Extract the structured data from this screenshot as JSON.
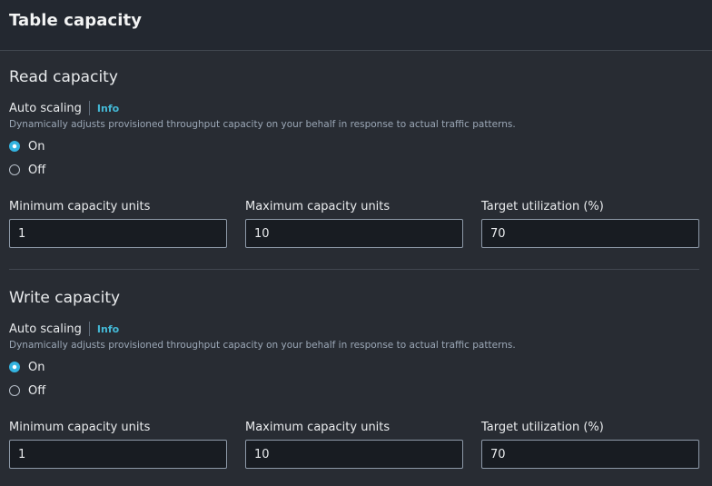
{
  "panel": {
    "title": "Table capacity"
  },
  "read_capacity": {
    "title": "Read capacity",
    "auto_scaling_label": "Auto scaling",
    "info_label": "Info",
    "description": "Dynamically adjusts provisioned throughput capacity on your behalf in response to actual traffic patterns.",
    "options": [
      {
        "label": "On",
        "selected": true
      },
      {
        "label": "Off",
        "selected": false
      }
    ],
    "min_label": "Minimum capacity units",
    "min_value": "1",
    "max_label": "Maximum capacity units",
    "max_value": "10",
    "target_label": "Target utilization (%)",
    "target_value": "70"
  },
  "write_capacity": {
    "title": "Write capacity",
    "auto_scaling_label": "Auto scaling",
    "info_label": "Info",
    "description": "Dynamically adjusts provisioned throughput capacity on your behalf in response to actual traffic patterns.",
    "options": [
      {
        "label": "On",
        "selected": true
      },
      {
        "label": "Off",
        "selected": false
      }
    ],
    "min_label": "Minimum capacity units",
    "min_value": "1",
    "max_label": "Maximum capacity units",
    "max_value": "10",
    "target_label": "Target utilization (%)",
    "target_value": "70"
  },
  "colors": {
    "background": "#282c33",
    "header_background": "#232830",
    "accent_link": "#44b9d6",
    "radio_selected": "#33b3e0",
    "input_background": "#181c22",
    "input_border": "#8d99a8"
  }
}
